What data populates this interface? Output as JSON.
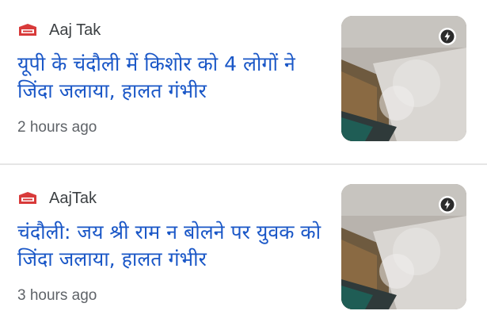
{
  "feed": {
    "items": [
      {
        "source": "Aaj Tak",
        "headline": "यूपी के चंदौली में किशोर को 4 लोगों ने जिंदा जलाया, हालत गंभीर",
        "time": "2 hours ago",
        "thumbnail_icon": "news-photo-thumbnail",
        "badge_icon": "amp-lightning-icon"
      },
      {
        "source": "AajTak",
        "headline": "चंदौली: जय श्री राम न बोलने पर युवक को जिंदा जलाया, हालत गंभीर",
        "time": "3 hours ago",
        "thumbnail_icon": "news-photo-thumbnail",
        "badge_icon": "amp-lightning-icon"
      }
    ]
  },
  "colors": {
    "headline": "#1a57c7",
    "source_logo": "#d83a3a",
    "meta_text": "#5f6368",
    "divider": "#e6e6e6"
  }
}
